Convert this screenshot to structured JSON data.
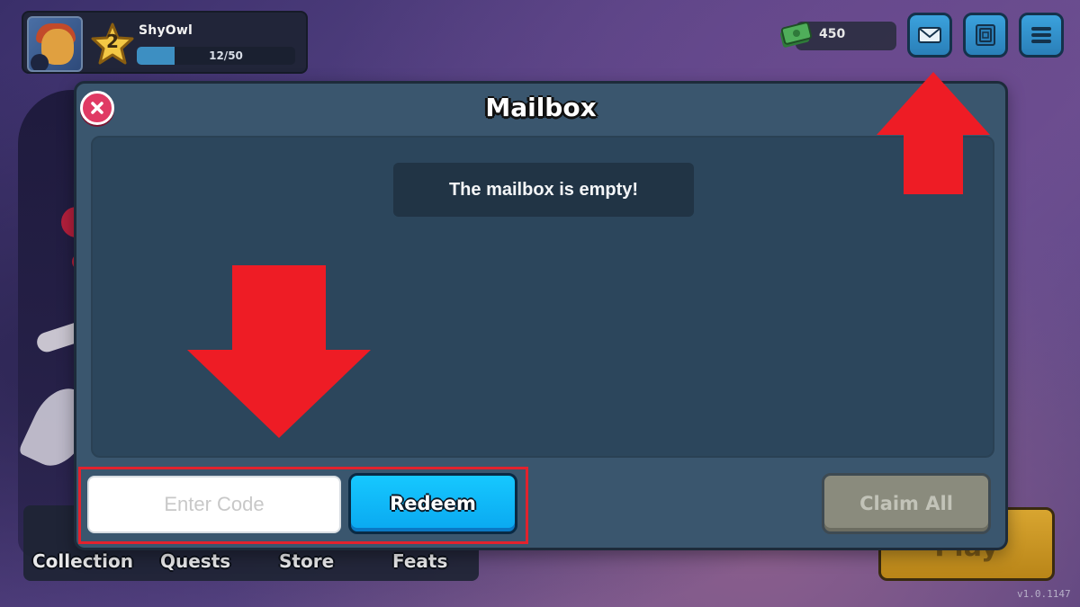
{
  "player": {
    "name": "ShyOwl",
    "level": "2",
    "xp_text": "12/50",
    "xp_fraction": 0.24
  },
  "currency": {
    "value": "450",
    "icon": "cash-stack-icon"
  },
  "top_buttons": {
    "mail_icon": "mail-icon",
    "codes_icon": "codes-icon",
    "menu_icon": "hamburger-menu-icon"
  },
  "bottom_nav": {
    "items": [
      {
        "label": "Collection"
      },
      {
        "label": "Quests"
      },
      {
        "label": "Store"
      },
      {
        "label": "Feats"
      }
    ]
  },
  "play_button": {
    "label": "Play"
  },
  "version": "v1.0.1147",
  "mailbox": {
    "title": "Mailbox",
    "empty_message": "The mailbox is empty!",
    "code_placeholder": "Enter Code",
    "code_value": "",
    "redeem_label": "Redeem",
    "claim_all_label": "Claim All"
  },
  "colors": {
    "accent_blue": "#16c8ff",
    "close_red": "#e03a64",
    "annotation_red": "#e2222d",
    "modal_bg": "#3a566e"
  }
}
